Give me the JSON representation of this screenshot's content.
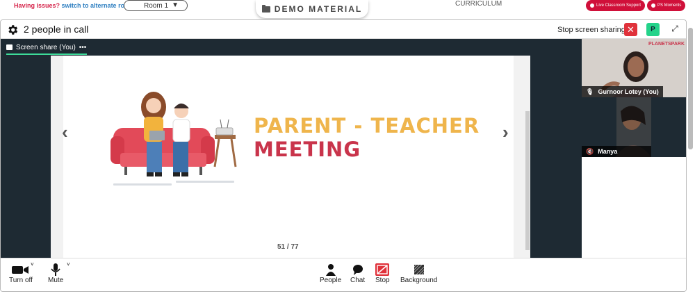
{
  "topbar": {
    "issues_text": "Having issues?",
    "alternate_link": "switch to alternate room",
    "room": "Room 1",
    "demo_material": "DEMO MATERIAL",
    "curriculum": "CURRICULUM",
    "live_support": "Live Classroom Support",
    "ps_moments": "PS Moments"
  },
  "call": {
    "title": "2 people in call",
    "stop_sharing": "Stop screen sharing",
    "participant_badge": "P"
  },
  "share_tab": {
    "label": "Screen share (You)",
    "menu": "•••"
  },
  "slide": {
    "line1": "PARENT - TEACHER",
    "line2": "MEETING",
    "page": "51 / 77"
  },
  "videos": {
    "user1": "Gurnoor Lotey (You)",
    "user2": "Manya",
    "logo": "PLANETSPARK"
  },
  "controls": {
    "turn_off": "Turn off",
    "mute": "Mute",
    "people": "People",
    "chat": "Chat",
    "stop": "Stop",
    "background": "Background"
  }
}
